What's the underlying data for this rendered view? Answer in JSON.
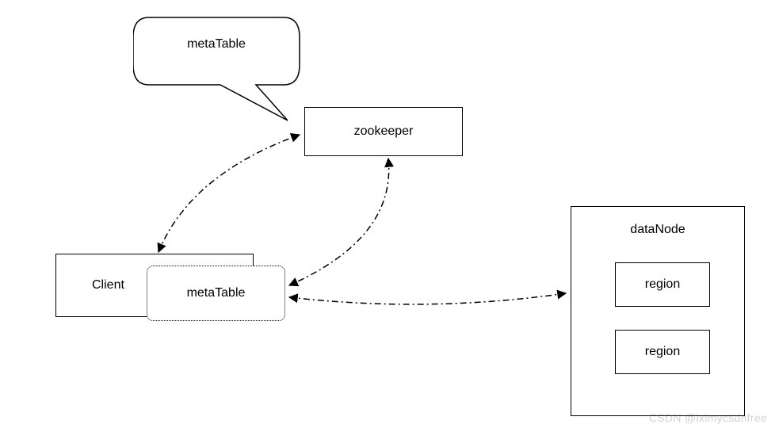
{
  "callout": {
    "label": "metaTable"
  },
  "zookeeper": {
    "label": "zookeeper"
  },
  "client": {
    "label": "Client"
  },
  "metaTableLocal": {
    "label": "metaTable"
  },
  "dataNode": {
    "label": "dataNode",
    "region1": "region",
    "region2": "region"
  },
  "watermark": "CSDN @lxlmycsdnfree"
}
